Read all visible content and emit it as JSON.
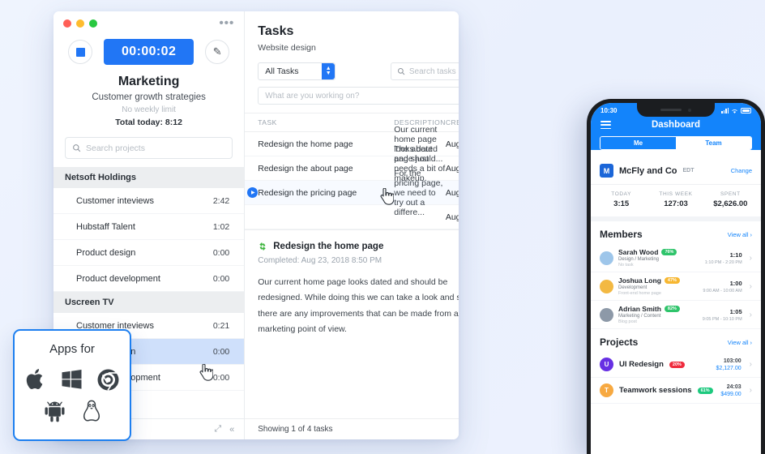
{
  "background_color": "#eef3fd",
  "accent_color": "#2176f5",
  "desktop": {
    "window_controls": [
      "close",
      "minimize",
      "maximize"
    ],
    "menu_icon": "•••",
    "timer": {
      "value": "00:00:02",
      "stop_label": "stop",
      "edit_label": "edit"
    },
    "project": {
      "title": "Marketing",
      "subtitle": "Customer growth strategies",
      "weekly_limit": "No weekly limit",
      "total_today": "Total today: 8:12"
    },
    "search": {
      "placeholder": "Search projects"
    },
    "groups": [
      {
        "name": "Netsoft Holdings",
        "items": [
          {
            "name": "Customer inteviews",
            "time": "2:42",
            "selected": false
          },
          {
            "name": "Hubstaff Talent",
            "time": "1:02",
            "selected": false
          },
          {
            "name": "Product design",
            "time": "0:00",
            "selected": false
          },
          {
            "name": "Product development",
            "time": "0:00",
            "selected": false
          }
        ]
      },
      {
        "name": "Uscreen TV",
        "items": [
          {
            "name": "Customer inteviews",
            "time": "0:21",
            "selected": false
          },
          {
            "name": "Product design",
            "time": "0:00",
            "selected": true
          },
          {
            "name": "Product development",
            "time": "0:00",
            "selected": false
          }
        ]
      }
    ],
    "footer": {
      "expand_icon": "expand",
      "collapse_icon": "collapse"
    }
  },
  "tasks": {
    "heading": "Tasks",
    "subheading": "Website design",
    "filter": {
      "value": "All Tasks"
    },
    "search": {
      "placeholder": "Search tasks"
    },
    "new_task": {
      "placeholder": "What are you working on?",
      "add_label": "+"
    },
    "columns": [
      "TASK",
      "DESCRIPTION",
      "CREATED"
    ],
    "rows": [
      {
        "task": "Redesign the home page",
        "description": "Our current home page looks dated and should...",
        "created": "Aug...",
        "playing": false
      },
      {
        "task": "Redesign the about page",
        "description": "The about page just needs a bit of makeup, bec...",
        "created": "Aug...",
        "playing": false
      },
      {
        "task": "Redesign the pricing page",
        "description": "For the pricing page, we need to try out a differe...",
        "created": "Aug...",
        "playing": true
      },
      {
        "task": "",
        "description": "",
        "created": "Aug...",
        "playing": false
      }
    ],
    "detail": {
      "title": "Redesign the home page",
      "completed": "Completed: Aug 23, 2018 8:50 PM",
      "body": "Our current home page looks dated and should be redesigned. While doing this we can take a look and see if there are any improvements that can be made from a marketing point of view."
    },
    "footer": "Showing 1 of 4 tasks"
  },
  "phone": {
    "status": {
      "time": "10:30"
    },
    "navbar": {
      "title": "Dashboard",
      "menu_icon": "hamburger-icon"
    },
    "segments": [
      {
        "label": "Me",
        "active": true
      },
      {
        "label": "Team",
        "active": false
      }
    ],
    "company": {
      "initial": "M",
      "name": "McFly and Co",
      "timezone": "EDT",
      "change_label": "Change"
    },
    "stats": [
      {
        "label": "TODAY",
        "value": "3:15"
      },
      {
        "label": "THIS WEEK",
        "value": "127:03"
      },
      {
        "label": "SPENT",
        "value": "$2,626.00"
      }
    ],
    "members_section": {
      "title": "Members",
      "view_all": "View all"
    },
    "members": [
      {
        "name": "Sarah Wood",
        "percent": "76%",
        "percent_color": "#2fc46b",
        "role": "Design / Marketing",
        "task": "No task",
        "duration": "1:10",
        "span": "1:10 PM - 2:20 PM",
        "avatar_color": "#9ec6ea"
      },
      {
        "name": "Joshua Long",
        "percent": "47%",
        "percent_color": "#f7b731",
        "role": "Development",
        "task": "Front-end home page",
        "duration": "1:00",
        "span": "9:00 AM - 10:00 AM",
        "avatar_color": "#f3b943"
      },
      {
        "name": "Adrian Smith",
        "percent": "82%",
        "percent_color": "#2fc46b",
        "role": "Marketing / Content",
        "task": "Blog post",
        "duration": "1:05",
        "span": "9:05 PM - 10:10 PM",
        "avatar_color": "#8d99a8"
      }
    ],
    "projects_section": {
      "title": "Projects",
      "view_all": "View all"
    },
    "projects": [
      {
        "initial": "U",
        "name": "UI Redesign",
        "percent": "20%",
        "percent_color": "#ef2b3d",
        "avatar_color": "#6730e3",
        "time": "103:00",
        "cost": "$2,127.00"
      },
      {
        "initial": "T",
        "name": "Teamwork sessions",
        "percent": "61%",
        "percent_color": "#1dc97e",
        "avatar_color": "#f7a941",
        "time": "24:03",
        "cost": "$499.00"
      }
    ]
  },
  "apps_card": {
    "title": "Apps for",
    "platforms": [
      "apple-icon",
      "windows-icon",
      "chrome-icon",
      "android-icon",
      "linux-icon"
    ]
  }
}
